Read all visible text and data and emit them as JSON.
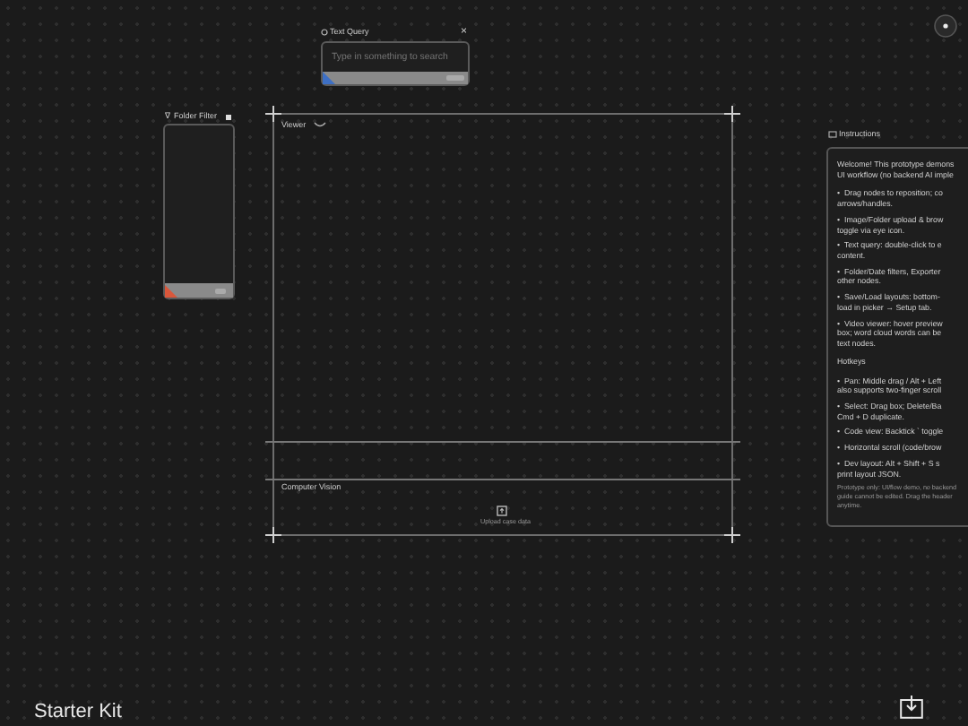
{
  "text_query": {
    "title": "Text Query",
    "close": "×",
    "placeholder": "Type in something to search"
  },
  "folder_filter": {
    "icon": "∇",
    "title": "Folder Filter"
  },
  "viewer": {
    "label": "Viewer"
  },
  "computer_vision": {
    "label": "Computer Vision",
    "upload_label": "Upload case data"
  },
  "instructions": {
    "title": "Instructions",
    "intro": "Welcome! This prototype demons\nUI workflow (no backend AI imple",
    "bullets": [
      "•  Drag nodes to reposition; co\narrows/handles.",
      "•  Image/Folder upload & brow\ntoggle via eye icon.",
      "•  Text query: double-click to e\ncontent.",
      "•  Folder/Date filters, Exporter\nother nodes.",
      "•  Save/Load layouts: bottom-\nload in picker → Setup tab.",
      "•  Video viewer: hover preview\nbox; word cloud words can be\ntext nodes."
    ],
    "hotkeys_heading": "Hotkeys",
    "hotkeys": [
      "•  Pan: Middle drag / Alt + Left\nalso supports two-finger scroll",
      "•  Select: Drag box; Delete/Ba\nCmd + D duplicate.",
      "•  Code view: Backtick ` toggle",
      "•  Horizontal scroll (code/brow",
      "•  Dev layout: Alt + Shift + S s\nprint layout JSON."
    ],
    "note": "Prototype only: UI/flow demo, no backend\nguide cannot be edited. Drag the header\nanytime."
  },
  "footer": {
    "title": "Starter Kit"
  }
}
